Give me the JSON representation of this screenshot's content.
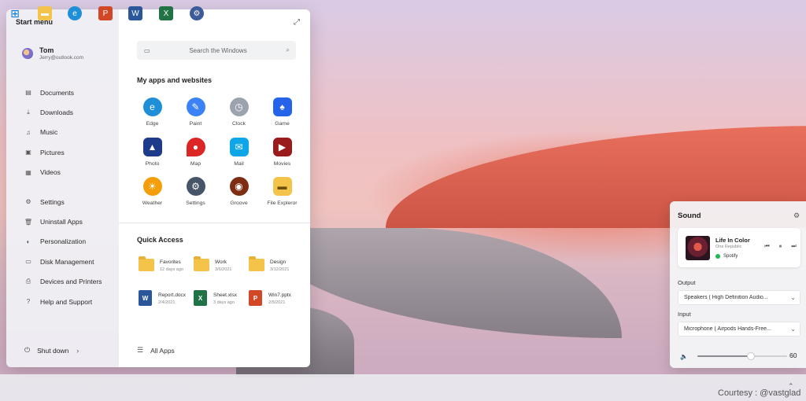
{
  "start_menu": {
    "title": "Start menu",
    "user": {
      "name": "Tom",
      "email": "Jerry@outlook.com"
    },
    "nav_primary": [
      {
        "label": "Documents",
        "icon": "document-icon"
      },
      {
        "label": "Downloads",
        "icon": "download-icon"
      },
      {
        "label": "Music",
        "icon": "music-icon"
      },
      {
        "label": "Pictures",
        "icon": "picture-icon"
      },
      {
        "label": "Videos",
        "icon": "video-icon"
      }
    ],
    "nav_secondary": [
      {
        "label": "Settings",
        "icon": "gear-icon"
      },
      {
        "label": "Uninstall Apps",
        "icon": "trash-icon"
      },
      {
        "label": "Personalization",
        "icon": "palette-icon"
      },
      {
        "label": "Disk Management",
        "icon": "disk-icon"
      },
      {
        "label": "Devices and Printers",
        "icon": "printer-icon"
      },
      {
        "label": "Help and Support",
        "icon": "help-icon"
      }
    ],
    "shutdown_label": "Shut down",
    "search_placeholder": "Search the Windows",
    "apps_title": "My apps and websites",
    "apps": [
      {
        "label": "Edge",
        "icon": "edge-icon",
        "color": "#1f8fd8"
      },
      {
        "label": "Paint",
        "icon": "paint-icon",
        "color": "#3b82f6"
      },
      {
        "label": "Clock",
        "icon": "clock-icon",
        "color": "#6b7280"
      },
      {
        "label": "Game",
        "icon": "game-icon",
        "color": "#2563eb"
      },
      {
        "label": "Photo",
        "icon": "photo-icon",
        "color": "#1e3a8a"
      },
      {
        "label": "Map",
        "icon": "map-pin-icon",
        "color": "#dc2626"
      },
      {
        "label": "Mail",
        "icon": "mail-icon",
        "color": "#0ea5e9"
      },
      {
        "label": "Movies",
        "icon": "movies-icon",
        "color": "#991b1b"
      },
      {
        "label": "Weather",
        "icon": "weather-icon",
        "color": "#f59e0b"
      },
      {
        "label": "Settings",
        "icon": "settings-app-icon",
        "color": "#475569"
      },
      {
        "label": "Groove",
        "icon": "groove-icon",
        "color": "#7c2d12"
      },
      {
        "label": "File Expleror",
        "icon": "folder-icon",
        "color": "#f4c34a"
      }
    ],
    "quick_access_title": "Quick Access",
    "quick_access": [
      {
        "name": "Favorites",
        "sub": "12 days ago",
        "type": "folder"
      },
      {
        "name": "Work",
        "sub": "3/6/2021",
        "type": "folder"
      },
      {
        "name": "Design",
        "sub": "3/12/2021",
        "type": "folder"
      },
      {
        "name": "Report.docx",
        "sub": "2/4/2021",
        "type": "word",
        "color": "#2b579a",
        "letter": "W"
      },
      {
        "name": "Sheet.xlsx",
        "sub": "3 days ago",
        "type": "excel",
        "color": "#217346",
        "letter": "X"
      },
      {
        "name": "Win7.pptx",
        "sub": "2/5/2021",
        "type": "powerpoint",
        "color": "#d24726",
        "letter": "P"
      }
    ],
    "all_apps_label": "All Apps"
  },
  "sound_panel": {
    "title": "Sound",
    "now_playing": {
      "track": "Life In Color",
      "artist": "One Republic",
      "source": "Spotify"
    },
    "output_label": "Output",
    "output_device": "Speakers ( High Definition Audio...",
    "input_label": "Input",
    "input_device": "Microphone ( Airpods Hands-Free...",
    "volume": 60
  },
  "taskbar": {
    "items": [
      {
        "name": "windows-start-button",
        "icon": "windows-logo-icon",
        "color": "#0078d4"
      },
      {
        "name": "file-explorer-button",
        "icon": "folder-icon",
        "color": "#f4c34a"
      },
      {
        "name": "edge-button",
        "icon": "edge-icon",
        "color": "#1f8fd8"
      },
      {
        "name": "powerpoint-button",
        "icon": "powerpoint-icon",
        "color": "#d24726"
      },
      {
        "name": "word-button",
        "icon": "word-icon",
        "color": "#2b579a"
      },
      {
        "name": "excel-button",
        "icon": "excel-icon",
        "color": "#217346"
      },
      {
        "name": "settings-button",
        "icon": "settings-icon",
        "color": "#3b5b9a"
      }
    ]
  },
  "courtesy": "Courtesy : @vastglad"
}
